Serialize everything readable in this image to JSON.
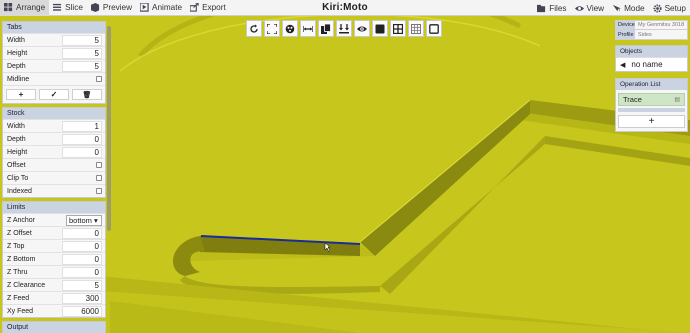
{
  "header": {
    "brand": "Kiri:Moto",
    "left_tabs": [
      {
        "label": "Arrange",
        "icon": "arrange-icon",
        "active": true
      },
      {
        "label": "Slice",
        "icon": "slice-icon"
      },
      {
        "label": "Preview",
        "icon": "preview-icon"
      },
      {
        "label": "Animate",
        "icon": "animate-icon"
      },
      {
        "label": "Export",
        "icon": "export-icon"
      }
    ],
    "right_tabs": [
      {
        "label": "Files",
        "icon": "files-icon"
      },
      {
        "label": "View",
        "icon": "eye-icon"
      },
      {
        "label": "Mode",
        "icon": "mode-icon"
      },
      {
        "label": "Setup",
        "icon": "gear-icon"
      }
    ]
  },
  "toolstrip": [
    "rotate-icon",
    "fullscreen-icon",
    "settings-wheel-icon",
    "dimension-icon",
    "copy-icon",
    "align-bottom-icon",
    "visibility-icon",
    "square-fill-icon",
    "grid-icon",
    "grid-alt-icon",
    "square-outline-icon"
  ],
  "left": {
    "tabs": {
      "title": "Tabs",
      "width_label": "Width",
      "width": "5",
      "height_label": "Height",
      "height": "5",
      "depth_label": "Depth",
      "depth": "5",
      "midline_label": "Midline",
      "add": "+",
      "ok": "✓",
      "del": "🗑"
    },
    "stock": {
      "title": "Stock",
      "width_label": "Width",
      "width": "1",
      "depth_label": "Depth",
      "depth": "0",
      "height_label": "Height",
      "height": "0",
      "offset_label": "Offset",
      "clipto_label": "Clip To",
      "indexed_label": "Indexed"
    },
    "limits": {
      "title": "Limits",
      "zanchor_label": "Z Anchor",
      "zanchor": "bottom",
      "zoffset_label": "Z Offset",
      "zoffset": "0",
      "ztop_label": "Z Top",
      "ztop": "0",
      "zbottom_label": "Z Bottom",
      "zbottom": "0",
      "zthru_label": "Z Thru",
      "zthru": "0",
      "zclear_label": "Z Clearance",
      "zclear": "5",
      "zfeed_label": "Z Feed",
      "zfeed": "300",
      "xyfeed_label": "Xy Feed",
      "xyfeed": "6000"
    },
    "output": {
      "title": "Output"
    }
  },
  "right": {
    "device_label": "Device",
    "device": "My Genmitsu 3018",
    "profile_label": "Profile",
    "profile": "Sides",
    "objects_title": "Objects",
    "object_name": "no name",
    "oplist_title": "Operation List",
    "op_name": "Trace",
    "add": "+"
  },
  "colors": {
    "model": "#c9c81e",
    "model_dark": "#8c8b12",
    "trace": "#1a2b9c",
    "panel_head": "#c9d3e2"
  }
}
